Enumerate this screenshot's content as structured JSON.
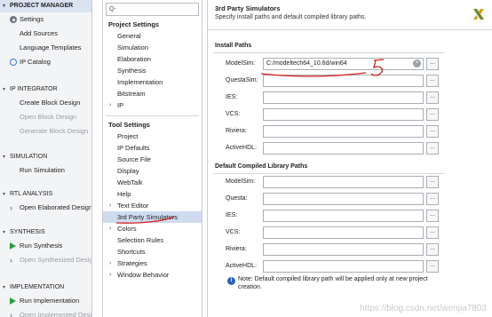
{
  "navigator": {
    "sections": [
      {
        "id": "project-manager",
        "title": "PROJECT MANAGER",
        "items": [
          {
            "label": "Settings",
            "icon": "gear-icon",
            "disabled": false
          },
          {
            "label": "Add Sources",
            "icon": "",
            "disabled": false
          },
          {
            "label": "Language Templates",
            "icon": "",
            "disabled": false
          },
          {
            "label": "IP Catalog",
            "icon": "ip-catalog-icon",
            "disabled": false
          }
        ]
      },
      {
        "id": "ip-integrator",
        "title": "IP INTEGRATOR",
        "items": [
          {
            "label": "Create Block Design",
            "icon": "",
            "disabled": false
          },
          {
            "label": "Open Block Design",
            "icon": "",
            "disabled": true
          },
          {
            "label": "Generate Block Design",
            "icon": "",
            "disabled": true
          }
        ]
      },
      {
        "id": "simulation",
        "title": "SIMULATION",
        "items": [
          {
            "label": "Run Simulation",
            "icon": "",
            "disabled": false
          }
        ]
      },
      {
        "id": "rtl-analysis",
        "title": "RTL ANALYSIS",
        "items": [
          {
            "label": "Open Elaborated Design",
            "icon": "chevron-right-icon",
            "disabled": false
          }
        ]
      },
      {
        "id": "synthesis",
        "title": "SYNTHESIS",
        "items": [
          {
            "label": "Run Synthesis",
            "icon": "play-icon",
            "disabled": false
          },
          {
            "label": "Open Synthesized Design",
            "icon": "chevron-right-icon",
            "disabled": true
          }
        ]
      },
      {
        "id": "implementation",
        "title": "IMPLEMENTATION",
        "items": [
          {
            "label": "Run Implementation",
            "icon": "play-icon",
            "disabled": false
          },
          {
            "label": "Open Implemented Design",
            "icon": "chevron-right-icon",
            "disabled": true
          }
        ]
      }
    ]
  },
  "tree": {
    "search_placeholder": "Q-",
    "project_settings_title": "Project Settings",
    "project_settings": [
      "General",
      "Simulation",
      "Elaboration",
      "Synthesis",
      "Implementation",
      "Bitstream",
      "IP"
    ],
    "tool_settings_title": "Tool Settings",
    "tool_settings": [
      "Project",
      "IP Defaults",
      "Source File",
      "Display",
      "WebTalk",
      "Help",
      "Text Editor",
      "3rd Party Simulators",
      "Colors",
      "Selection Rules",
      "Shortcuts",
      "Strategies",
      "Window Behavior"
    ],
    "selected": "3rd Party Simulators"
  },
  "content": {
    "title": "3rd Party Simulators",
    "subtitle": "Specify install paths and default compiled library paths.",
    "install_paths_title": "Install Paths",
    "install_paths": [
      {
        "label": "ModelSim:",
        "value": "C:/modeltech64_10.6d/win64"
      },
      {
        "label": "QuestaSim:",
        "value": ""
      },
      {
        "label": "IES:",
        "value": ""
      },
      {
        "label": "VCS:",
        "value": ""
      },
      {
        "label": "Riviera:",
        "value": ""
      },
      {
        "label": "ActiveHDL:",
        "value": ""
      }
    ],
    "library_paths_title": "Default Compiled Library Paths",
    "library_paths": [
      {
        "label": "ModelSim:",
        "value": ""
      },
      {
        "label": "Questa:",
        "value": ""
      },
      {
        "label": "IES:",
        "value": ""
      },
      {
        "label": "VCS:",
        "value": ""
      },
      {
        "label": "Riviera:",
        "value": ""
      },
      {
        "label": "ActiveHDL:",
        "value": ""
      }
    ],
    "browse_label": "...",
    "clear_label": "×",
    "note": "Note: Default compiled library path will be applied only at new project creation.",
    "note_icon": "info-icon"
  },
  "watermark": "https://blog.csdn.net/wenjia7803",
  "colors": {
    "accent": "#2f63b8",
    "selection": "#cfdcf0",
    "annotation": "#d21f1f"
  }
}
